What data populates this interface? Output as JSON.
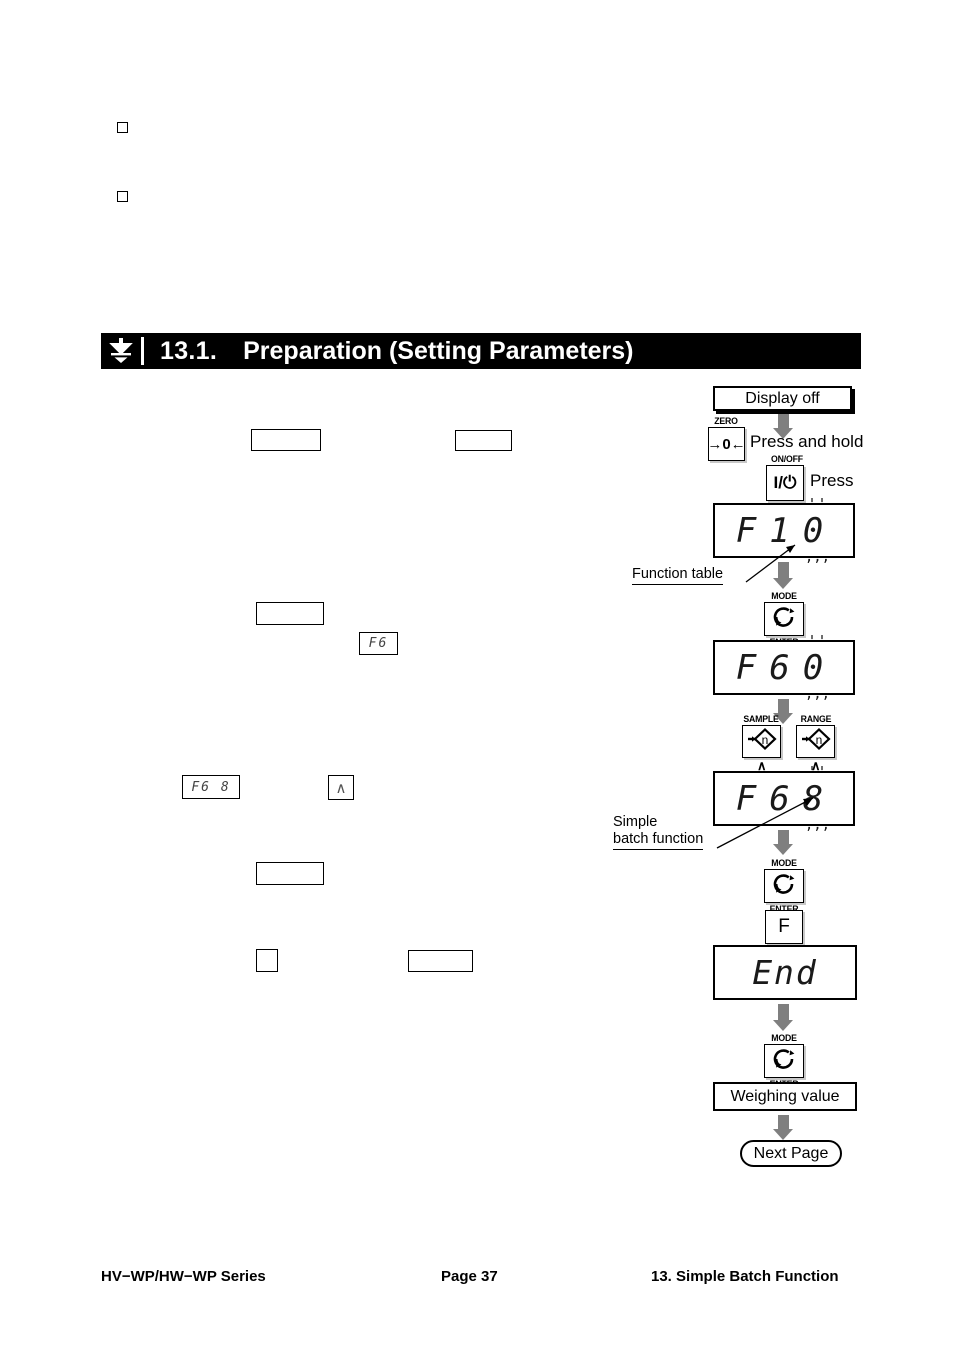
{
  "section": {
    "icon": "weigh-press-icon",
    "number": "13.1.",
    "title": "Preparation (Setting Parameters)"
  },
  "bullets": [
    {
      "name": "bullet-marker-1"
    },
    {
      "name": "bullet-marker-2"
    }
  ],
  "inline_displays": [
    {
      "name": "inline-display-f6",
      "text": "F6"
    },
    {
      "name": "inline-display-f6-8",
      "text": "F6 8"
    }
  ],
  "inline_keys": [
    {
      "name": "inline-key-caret",
      "text": "∧"
    }
  ],
  "flow": {
    "start_label": "Display off",
    "press_and_hold_label": "Press and hold",
    "press_label": "Press",
    "keys": {
      "zero": {
        "cap_top": "ZERO",
        "glyph": "→0←"
      },
      "on_off": {
        "cap_top": "ON/OFF",
        "glyph": "I/⏻"
      },
      "mode_enter": {
        "cap_top": "MODE",
        "cap_bottom": "ENTER",
        "glyph": "mode-cycle-icon"
      },
      "sample": {
        "cap_top": "SAMPLE",
        "glyph": "→n",
        "caret": "∧"
      },
      "range": {
        "cap_top": "RANGE",
        "glyph": "→n",
        "caret": "∧"
      },
      "f": {
        "glyph": "F"
      }
    },
    "displays": [
      {
        "name": "display-f-1-0",
        "chars": [
          "F",
          "1",
          "0"
        ],
        "blink_index": 2
      },
      {
        "name": "display-f-6-0",
        "chars": [
          "F",
          "6",
          "0"
        ],
        "blink_index": 2
      },
      {
        "name": "display-f-6-8",
        "chars": [
          "F",
          "6",
          "8"
        ],
        "blink_index": 2
      },
      {
        "name": "display-end",
        "text": "End"
      }
    ],
    "annotations": {
      "function_table": "Function table",
      "simple_batch_line1": "Simple",
      "simple_batch_line2": "batch function"
    },
    "weighing_value_label": "Weighing value",
    "next_page_label": "Next Page"
  },
  "footer": {
    "left": "HV−WP/HW−WP Series",
    "center": "Page 37",
    "right": "13. Simple Batch Function"
  }
}
